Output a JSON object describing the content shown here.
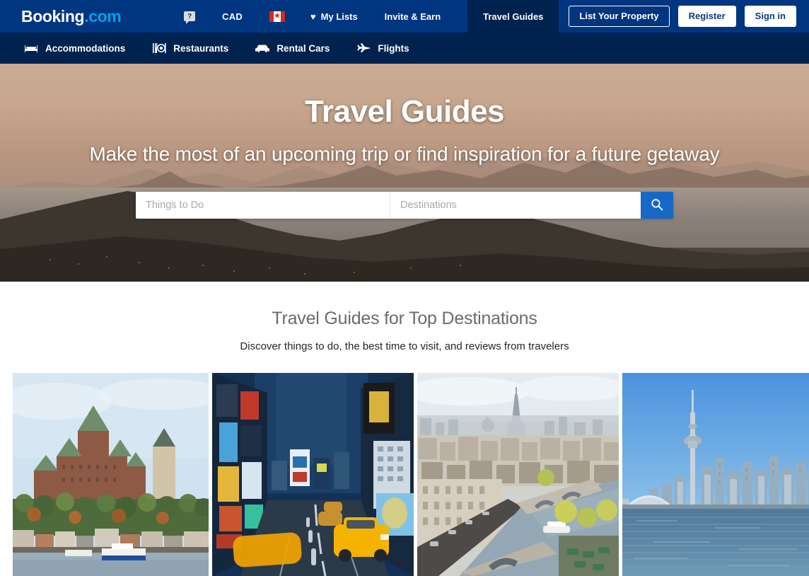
{
  "header": {
    "logo_main": "Booking",
    "logo_suffix": ".com",
    "help_icon": "question-speech-bubble-icon",
    "currency": "CAD",
    "flag": "canada-flag-icon",
    "flag_glyph": "⚑",
    "my_lists": "My Lists",
    "heart_glyph": "♥",
    "invite_earn": "Invite & Earn",
    "travel_guides": "Travel Guides",
    "list_your_property": "List Your Property",
    "register": "Register",
    "sign_in": "Sign in"
  },
  "subnav": {
    "items": [
      {
        "label": "Accommodations",
        "icon": "bed-icon"
      },
      {
        "label": "Restaurants",
        "icon": "cutlery-plate-icon"
      },
      {
        "label": "Rental Cars",
        "icon": "car-icon"
      },
      {
        "label": "Flights",
        "icon": "airplane-icon"
      }
    ]
  },
  "hero": {
    "title": "Travel Guides",
    "subtitle": "Make the most of an upcoming trip or find inspiration for a future getaway",
    "things_to_do_placeholder": "Things to Do",
    "things_to_do_value": "",
    "destinations_placeholder": "Destinations",
    "destinations_value": "",
    "search_icon": "search-icon",
    "search_button_color": "#1668c6",
    "image_subject": "Rio de Janeiro bay at sunset"
  },
  "section": {
    "title": "Travel Guides for Top Destinations",
    "subtitle": "Discover things to do, the best time to visit, and reviews from travelers"
  },
  "cards": [
    {
      "name": "quebec-city",
      "subject": "Château Frontenac above the St. Lawrence River, Quebec City"
    },
    {
      "name": "new-york-city",
      "subject": "Times Square with yellow taxis, New York City"
    },
    {
      "name": "paris",
      "subject": "Seine river, bridges and Eiffel Tower, Paris"
    },
    {
      "name": "toronto",
      "subject": "CN Tower and skyline across Lake Ontario, Toronto"
    }
  ],
  "colors": {
    "brand_navy": "#003580",
    "brand_navy_dark": "#00224f",
    "brand_cyan": "#00a2e8",
    "accent_blue": "#1668c6"
  }
}
